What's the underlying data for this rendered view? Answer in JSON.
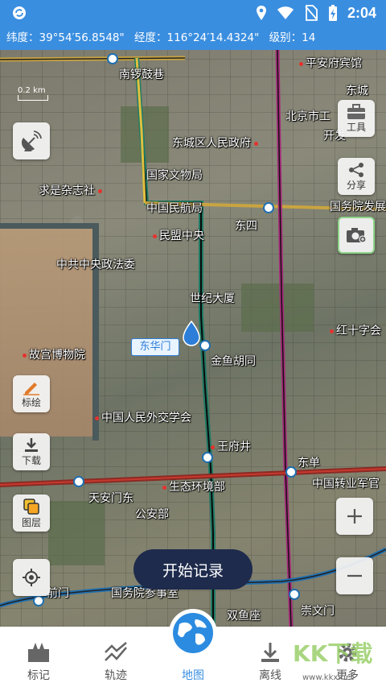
{
  "status_bar": {
    "time": "2:04",
    "icons": [
      "sync-icon",
      "location-icon",
      "wifi-icon",
      "no-sim-icon",
      "battery-charging-icon"
    ]
  },
  "coord_bar": {
    "lat_label": "纬度：",
    "lat_value": "39°54′56.8548\"",
    "lon_label": "经度：",
    "lon_value": "116°24′14.4324\"",
    "level_label": "级别：",
    "level_value": "14"
  },
  "map": {
    "scale_label": "0.2 km",
    "labels": [
      "南锣鼓巷",
      "平安府宾馆",
      "东城",
      "北京市工",
      "开发",
      "东城区人民政府",
      "国家文物局",
      "求是杂志社",
      "中国民航局",
      "国务院发展",
      "东四",
      "民盟中央",
      "中共中央政法委",
      "世纪大厦",
      "红十字会",
      "故宫博物院",
      "金鱼胡同",
      "中国人民外交学会",
      "王府井",
      "东单",
      "天安门东",
      "生态环境部",
      "中国转业军官",
      "公安部",
      "前门",
      "国务院参事室",
      "双鱼座",
      "崇文门",
      "天"
    ],
    "landmark": "东华门",
    "record_button": "开始记录"
  },
  "side_buttons": {
    "tools": "工具",
    "share": "分享",
    "mark": "标绘",
    "download": "下载",
    "layers": "图层"
  },
  "bottom_nav": {
    "items": [
      {
        "label": "标记",
        "icon": "marker-icon"
      },
      {
        "label": "轨迹",
        "icon": "track-icon"
      },
      {
        "label": "地图",
        "icon": "globe-icon"
      },
      {
        "label": "离线",
        "icon": "download-icon"
      },
      {
        "label": "更多",
        "icon": "gear-icon"
      }
    ],
    "active_index": 2
  },
  "watermark": {
    "brand": "KK下载",
    "site": "www.kkx.net"
  },
  "colors": {
    "accent": "#3a8ee0",
    "record_bg": "#1e2b4c"
  }
}
